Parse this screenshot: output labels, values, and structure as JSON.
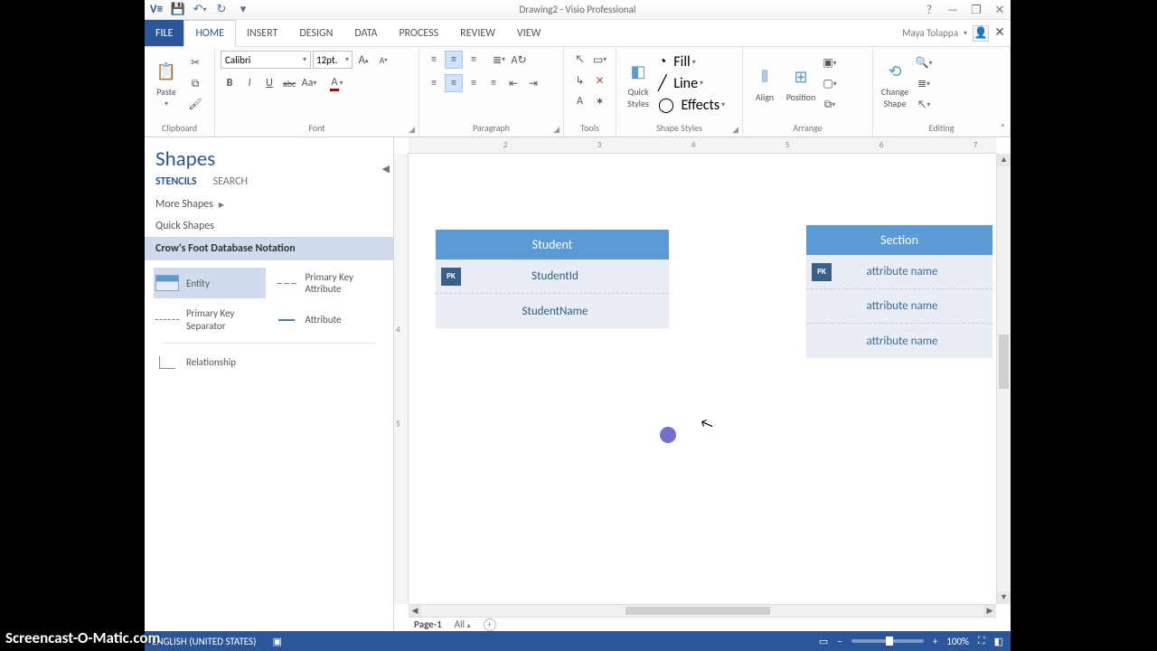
{
  "titlebar": {
    "title": "Drawing2 - Visio Professional"
  },
  "win": {
    "help": "?",
    "min": "—",
    "restore": "❐",
    "close": "✕"
  },
  "tabs": {
    "file": "FILE",
    "home": "HOME",
    "insert": "INSERT",
    "design": "DESIGN",
    "data": "DATA",
    "process": "PROCESS",
    "review": "REVIEW",
    "view": "VIEW"
  },
  "user": {
    "name": "Maya Tolappa"
  },
  "ribbon": {
    "clipboard": {
      "paste": "Paste",
      "label": "Clipboard"
    },
    "font": {
      "name": "Calibri",
      "size": "12pt.",
      "bold": "B",
      "italic": "I",
      "underline": "U",
      "strike": "abc",
      "case": "Aa",
      "label": "Font"
    },
    "paragraph": {
      "label": "Paragraph"
    },
    "tools": {
      "label": "Tools"
    },
    "shapestyles": {
      "quick": "Quick Styles",
      "fill": "Fill",
      "line": "Line",
      "effects": "Effects",
      "label": "Shape Styles"
    },
    "arrange": {
      "align": "Align",
      "position": "Position",
      "label": "Arrange"
    },
    "editing": {
      "change": "Change Shape",
      "label": "Editing"
    }
  },
  "shapes": {
    "title": "Shapes",
    "tab_stencils": "STENCILS",
    "tab_search": "SEARCH",
    "more": "More Shapes",
    "quick": "Quick Shapes",
    "selected_stencil": "Crow's Foot Database Notation",
    "masters": {
      "entity": "Entity",
      "pk_attr": "Primary Key Attribute",
      "pk_sep": "Primary Key Separator",
      "attr": "Attribute",
      "rel": "Relationship"
    }
  },
  "canvas": {
    "h_ticks": [
      "2",
      "3",
      "4",
      "5",
      "6",
      "7"
    ],
    "v_ticks": [
      "4",
      "5"
    ],
    "entity1": {
      "name": "Student",
      "rows": [
        {
          "pk": "PK",
          "label": "StudentId"
        },
        {
          "pk": "",
          "label": "StudentName"
        }
      ]
    },
    "entity2": {
      "name": "Section",
      "rows": [
        {
          "pk": "PK",
          "label": "attribute name"
        },
        {
          "pk": "",
          "label": "attribute name"
        },
        {
          "pk": "",
          "label": "attribute name"
        }
      ]
    }
  },
  "pagetabs": {
    "page": "Page-1",
    "all": "All",
    "add": "+"
  },
  "status": {
    "lang": "ENGLISH (UNITED STATES)",
    "zoom": "100%"
  },
  "watermark": "Screencast-O-Matic.com"
}
